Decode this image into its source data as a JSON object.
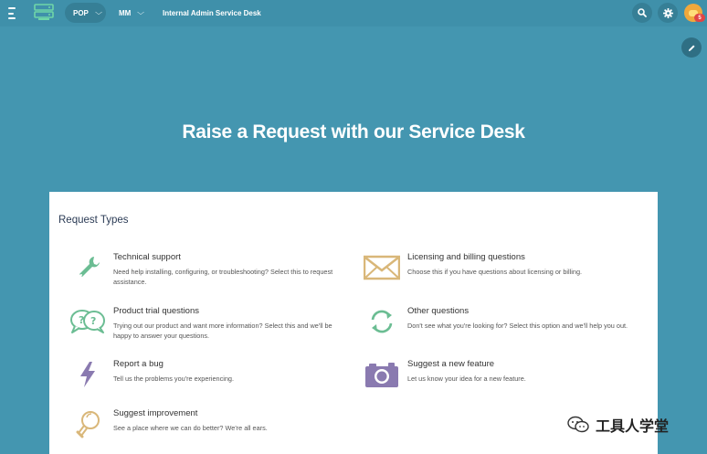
{
  "topbar": {
    "selector": {
      "label": "POP"
    },
    "project": {
      "label": "MM"
    },
    "page_link": "Internal Admin Service Desk",
    "notifications_count": "5"
  },
  "hero": {
    "title": "Raise a Request with our Service Desk"
  },
  "request_types": {
    "heading": "Request Types",
    "items": [
      {
        "name": "Technical support",
        "description": "Need help installing, configuring, or troubleshooting? Select this to request assistance.",
        "icon": "wrench-icon",
        "color": "#6bbd93"
      },
      {
        "name": "Licensing and billing questions",
        "description": "Choose this if you have questions about licensing or billing.",
        "icon": "envelope-icon",
        "color": "#d9b779"
      },
      {
        "name": "Product trial questions",
        "description": "Trying out our product and want more information? Select this and we'll be happy to answer your questions.",
        "icon": "question-bubbles-icon",
        "color": "#6bbd93"
      },
      {
        "name": "Other questions",
        "description": "Don't see what you're looking for? Select this option and we'll help you out.",
        "icon": "refresh-icon",
        "color": "#6bbd93"
      },
      {
        "name": "Report a bug",
        "description": "Tell us the problems you're experiencing.",
        "icon": "lightning-icon",
        "color": "#8a7ab0"
      },
      {
        "name": "Suggest a new feature",
        "description": "Let us know your idea for a new feature.",
        "icon": "camera-icon",
        "color": "#8a7ab0"
      },
      {
        "name": "Suggest improvement",
        "description": "See a place where we can do better? We're all ears.",
        "icon": "lightbulb-icon",
        "color": "#d9b779"
      }
    ]
  },
  "watermark": {
    "text": "工具人学堂"
  }
}
